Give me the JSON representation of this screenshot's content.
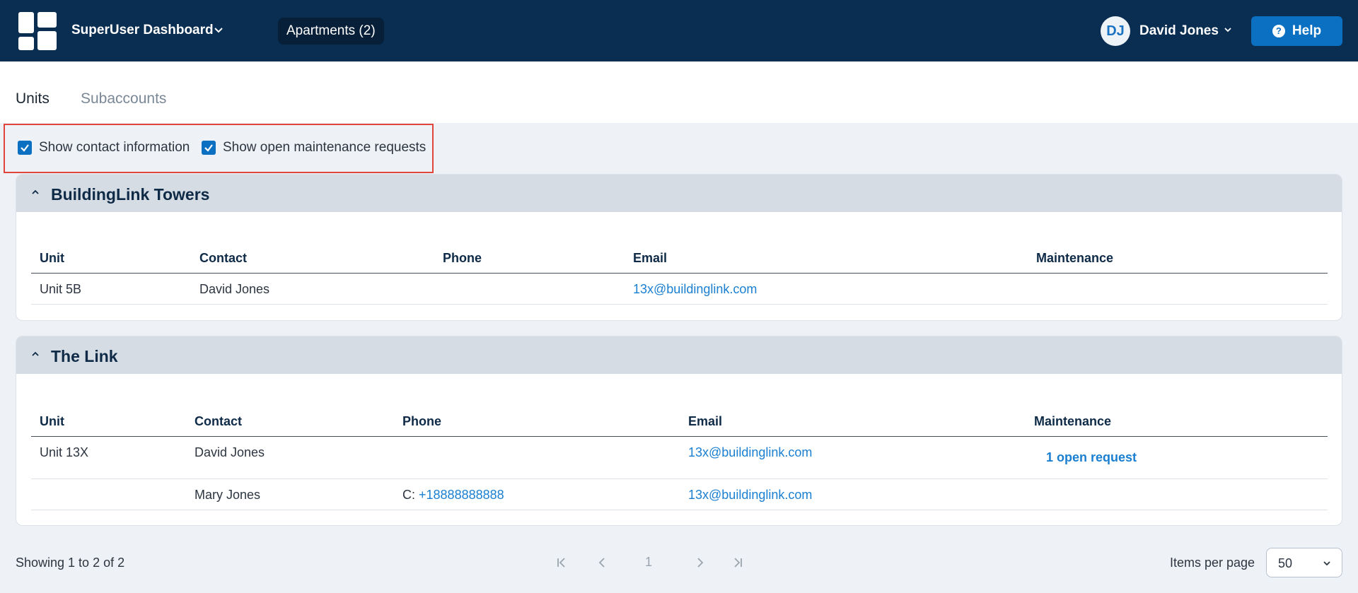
{
  "header": {
    "app_title": "SuperUser Dashboard",
    "apartments_label": "Apartments (2)",
    "user_initials": "DJ",
    "user_name": "David Jones",
    "help_label": "Help",
    "bg_color": "#0a2e52",
    "accent_color": "#0b6fc2"
  },
  "tabs": [
    {
      "label": "Units",
      "active": true
    },
    {
      "label": "Subaccounts",
      "active": false
    }
  ],
  "filters": {
    "show_contact": {
      "label": "Show contact information",
      "checked": true
    },
    "show_maintenance": {
      "label": "Show open maintenance requests",
      "checked": true
    }
  },
  "buildings": [
    {
      "name": "BuildingLink Towers",
      "columns": [
        "Unit",
        "Contact",
        "Phone",
        "Email",
        "Maintenance"
      ],
      "rows": [
        {
          "unit": "Unit 5B",
          "contact": "David Jones",
          "phone": "",
          "email": "13x@buildinglink.com",
          "maintenance": ""
        }
      ]
    },
    {
      "name": "The Link",
      "columns": [
        "Unit",
        "Contact",
        "Phone",
        "Email",
        "Maintenance"
      ],
      "rows": [
        {
          "unit": "Unit 13X",
          "contact": "David Jones",
          "phone_prefix": "",
          "phone": "",
          "email": "13x@buildinglink.com",
          "maintenance": "1 open request"
        },
        {
          "unit": "",
          "contact": "Mary Jones",
          "phone_prefix": "C:",
          "phone": "+18888888888",
          "email": "13x@buildinglink.com",
          "maintenance": ""
        }
      ]
    }
  ],
  "footer": {
    "showing": "Showing 1 to 2 of 2",
    "current_page": "1",
    "items_per_page_label": "Items per page",
    "items_per_page_value": "50"
  }
}
